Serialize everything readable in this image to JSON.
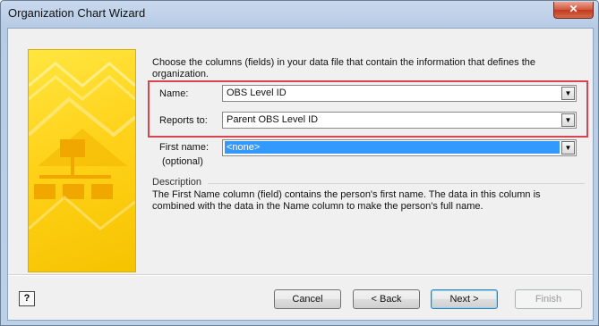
{
  "window": {
    "title": "Organization Chart Wizard",
    "close_glyph": "✕"
  },
  "instruction": "Choose the columns (fields) in your data file that contain the information that defines the organization.",
  "fields": {
    "name": {
      "label": "Name:",
      "value": "OBS Level ID"
    },
    "reports_to": {
      "label": "Reports to:",
      "value": "Parent OBS Level ID"
    },
    "first_name": {
      "label": "First name:",
      "sublabel": "(optional)",
      "value": "<none>"
    }
  },
  "description": {
    "heading": "Description",
    "text": "The First Name column (field) contains the person's first name. The data in this column is combined with the data in the Name column to make the person's full name."
  },
  "buttons": {
    "help": "?",
    "cancel": "Cancel",
    "back": "< Back",
    "next": "Next >",
    "finish": "Finish"
  },
  "icons": {
    "dropdown": "▼",
    "help": "help-icon",
    "close": "close-icon"
  },
  "colors": {
    "highlight_border": "#d64550",
    "selection": "#3399ff",
    "art_yellow": "#ffd21a"
  }
}
